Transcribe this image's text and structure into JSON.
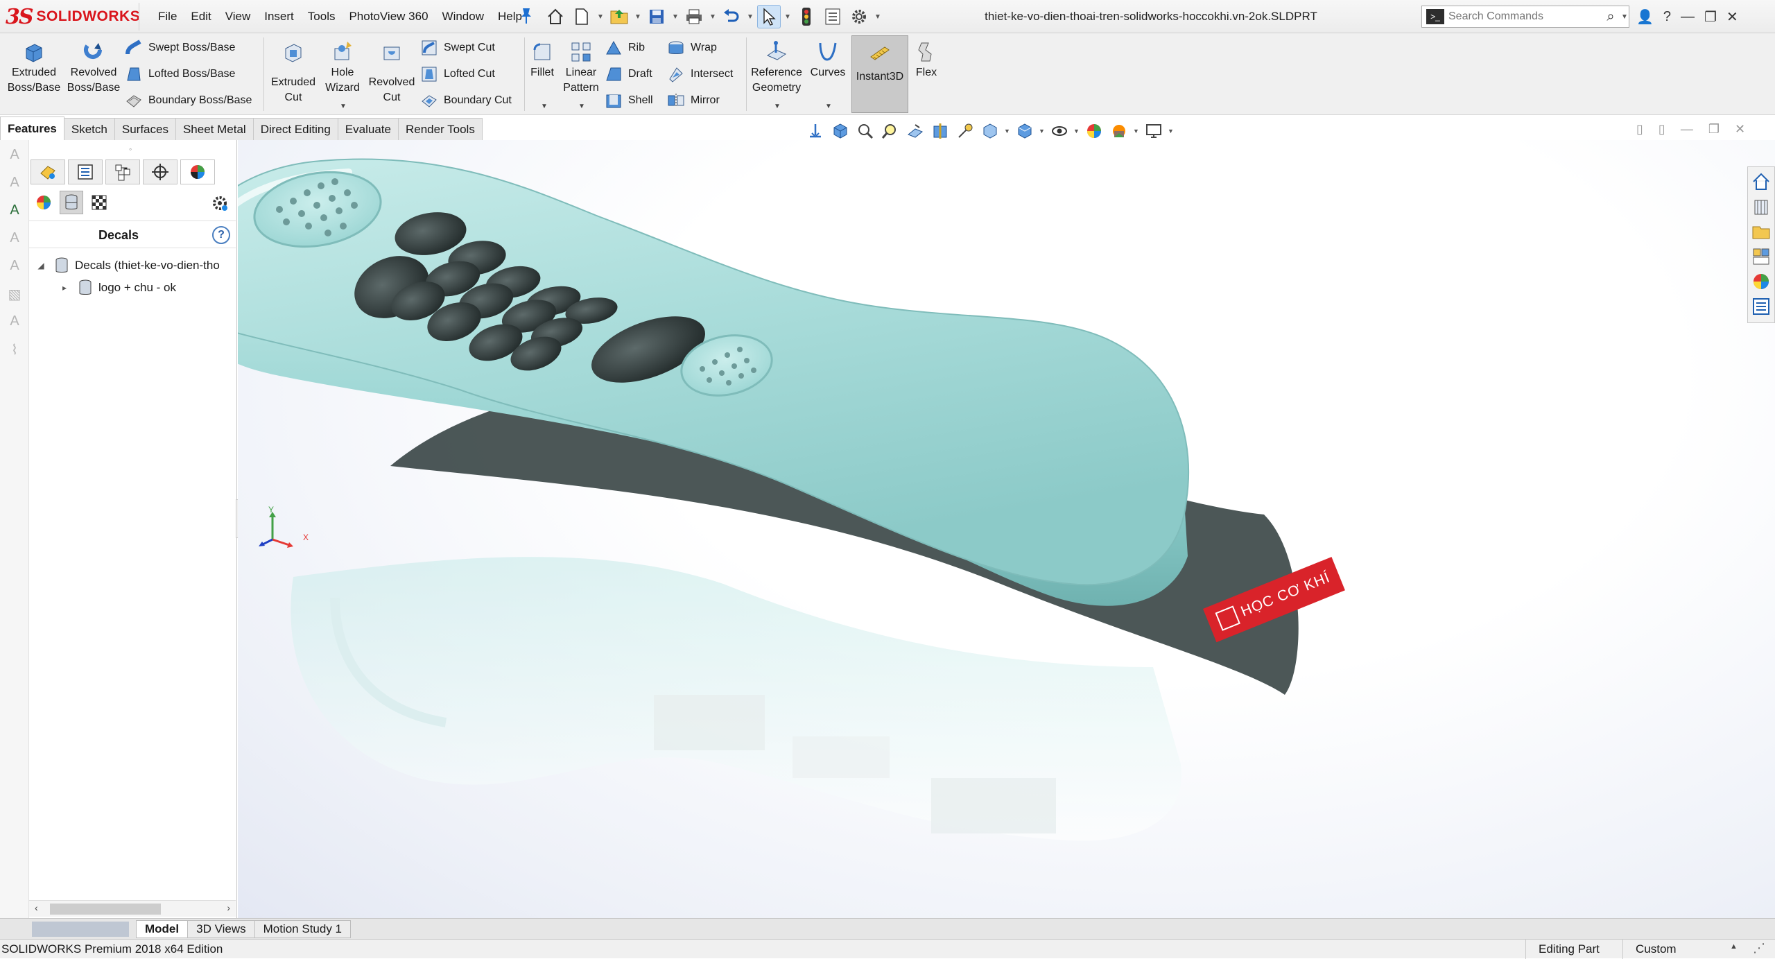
{
  "app": {
    "brand_prefix": "3S",
    "brand_name": "SOLIDWORKS",
    "document_title": "thiet-ke-vo-dien-thoai-tren-solidworks-hoccokhi.vn-2ok.SLDPRT"
  },
  "menu": [
    "File",
    "Edit",
    "View",
    "Insert",
    "Tools",
    "PhotoView 360",
    "Window",
    "Help"
  ],
  "search": {
    "placeholder": "Search Commands"
  },
  "window_controls": {
    "user": "👤",
    "help": "?",
    "minimize": "—",
    "restore": "❐",
    "close": "✕"
  },
  "commands": {
    "extruded_boss": "Extruded Boss/Base",
    "revolved_boss": "Revolved Boss/Base",
    "swept_boss": "Swept Boss/Base",
    "lofted_boss": "Lofted Boss/Base",
    "boundary_boss": "Boundary Boss/Base",
    "extruded_cut": "Extruded Cut",
    "hole_wizard": "Hole Wizard",
    "revolved_cut": "Revolved Cut",
    "swept_cut": "Swept Cut",
    "lofted_cut": "Lofted Cut",
    "boundary_cut": "Boundary Cut",
    "fillet": "Fillet",
    "linear_pattern": "Linear Pattern",
    "rib": "Rib",
    "draft": "Draft",
    "shell": "Shell",
    "wrap": "Wrap",
    "intersect": "Intersect",
    "mirror": "Mirror",
    "reference_geometry": "Reference Geometry",
    "curves": "Curves",
    "instant3d": "Instant3D",
    "flex": "Flex"
  },
  "tabs": [
    "Features",
    "Sketch",
    "Surfaces",
    "Sheet Metal",
    "Direct Editing",
    "Evaluate",
    "Render Tools"
  ],
  "active_tab": "Features",
  "panel": {
    "title": "Decals",
    "help": "?",
    "tree": [
      {
        "label": "Decals (thiet-ke-vo-dien-tho",
        "expanded": true
      },
      {
        "label": "logo + chu - ok",
        "expanded": false
      }
    ]
  },
  "model": {
    "decal_text": "HỌC CƠ KHÍ",
    "body_color": "#a9dcda",
    "decal_color": "#d9232a"
  },
  "triad": {
    "x": "X",
    "y": "Y"
  },
  "bottom_tabs": [
    "Model",
    "3D Views",
    "Motion Study 1"
  ],
  "active_bottom_tab": "Model",
  "status": {
    "edition": "SOLIDWORKS Premium 2018 x64 Edition",
    "mode": "Editing Part",
    "units": "Custom"
  },
  "colors": {
    "accent": "#1d6fd1",
    "brand_red": "#d9151c"
  }
}
